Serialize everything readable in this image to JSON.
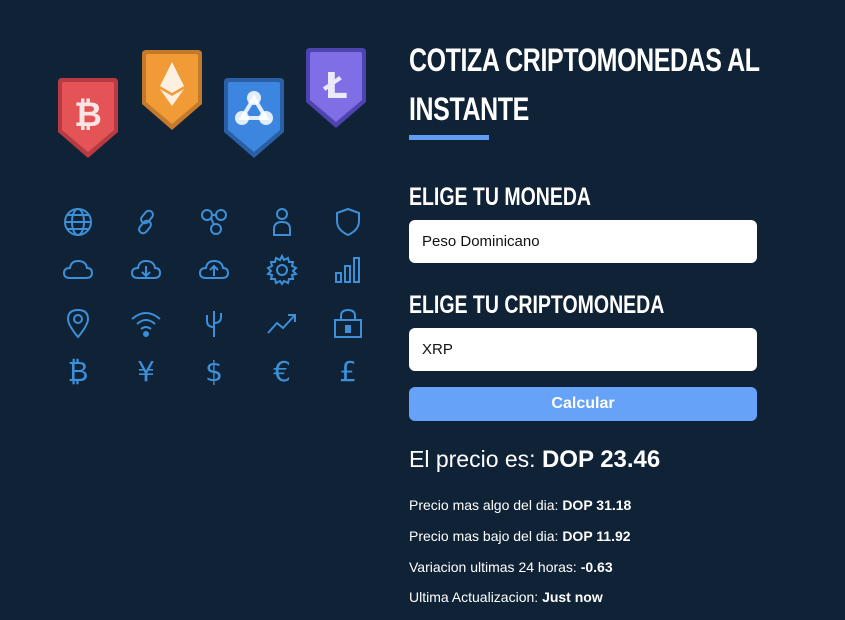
{
  "coins": [
    {
      "name": "bitcoin",
      "symbol": "₿",
      "color": "#e45457"
    },
    {
      "name": "ethereum",
      "symbol": "Ξ",
      "color": "#f19b37"
    },
    {
      "name": "ripple",
      "symbol": "✕",
      "color": "#3d86df"
    },
    {
      "name": "litecoin",
      "symbol": "Ł",
      "color": "#7f6ee5"
    }
  ],
  "icons": [
    "globe-icon",
    "link-icon",
    "nodes-icon",
    "user-icon",
    "shield-icon",
    "cloud-icon",
    "cloud-download-icon",
    "cloud-upload-icon",
    "gear-icon",
    "bar-chart-icon",
    "location-pin-icon",
    "wifi-icon",
    "cactus-icon",
    "trend-up-icon",
    "lock-icon",
    "bitcoin-icon",
    "yen-icon",
    "dollar-icon",
    "euro-icon",
    "pound-icon"
  ],
  "glyphs": {
    "bitcoin": "₿",
    "yen": "¥",
    "dollar": "$",
    "euro": "€",
    "pound": "£"
  },
  "heading": {
    "title": "Cotiza Criptomonedas al Instante"
  },
  "form": {
    "currency_label": "Elige tu Moneda",
    "currency_value": "Peso Dominicano",
    "crypto_label": "Elige tu Criptomoneda",
    "crypto_value": "XRP",
    "submit_label": "Calcular"
  },
  "result": {
    "price_label": "El precio es: ",
    "price_value": "DOP 23.46",
    "high_label": "Precio mas algo del dia: ",
    "high_value": "DOP 31.18",
    "low_label": "Precio mas bajo del dia: ",
    "low_value": "DOP 11.92",
    "change_label": "Variacion ultimas 24 horas: ",
    "change_value": "-0.63",
    "updated_label": "Ultima Actualizacion: ",
    "updated_value": "Just now"
  },
  "colors": {
    "background": "#0f2236",
    "accent": "#66a2f8",
    "icon": "#3d8fd8"
  }
}
